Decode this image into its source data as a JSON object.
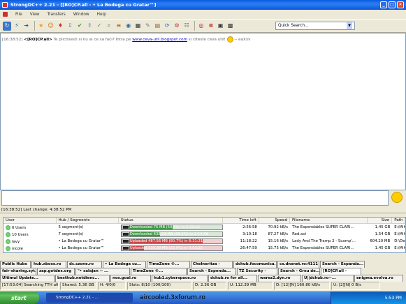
{
  "window": {
    "title": "StrongDC++ 2.21 - [[RO]CP.all - • La Bodega cu Gratar™]"
  },
  "menu": [
    "File",
    "View",
    "Transfers",
    "Window",
    "Help"
  ],
  "search": {
    "value": "Quick Search..."
  },
  "chat": {
    "time": "[16:38:52]",
    "nick": "<[RO]CP.all>",
    "text": " Te plictisesti si nu ai ce sa faci? Intra pe ",
    "link": "www.ceva-util.blogspot.com",
    "text2": " si citeste ceva util!",
    "tail": " -- eaXxv"
  },
  "status_line": "[16:38:52] Last change: 4:38:52 PM",
  "transfers": {
    "headers": [
      "User",
      "Hub / Segments",
      "Status",
      "Time left",
      "Speed",
      "Filename",
      "Size",
      "Path"
    ],
    "rows": [
      {
        "user": "6 Users",
        "hub": "5 segment(s)",
        "status": "Downloaded 76 MB (50.5%) in 2:32:15",
        "pct": 50.5,
        "type": "dl",
        "time": "2:56:58",
        "speed": "70.92 kB/s",
        "file": "The Expendables SUPER CLARI...",
        "size": "1.45 GB",
        "path": "E:\\Mihai\\"
      },
      {
        "user": "10 Users",
        "hub": "7 segment(s)",
        "status": "Downloaded 638.02 MB (38.5%) in 2:12:58",
        "pct": 38.5,
        "type": "dl",
        "time": "3:10:18",
        "speed": "87.27 kB/s",
        "file": "Red.avi",
        "size": "1.54 GB",
        "path": "E:\\Mihai\\"
      },
      {
        "user": "lavy",
        "hub": "• La Bodega cu Gratar™",
        "status": "Uploaded 487.56 MB (80.7%) in 6:31:31",
        "pct": 80.7,
        "type": "ul",
        "time": "11:18:22",
        "speed": "15.16 kB/s",
        "file": "Lady And The Tramp 2 - Scamp'...",
        "size": "604.20 MB",
        "path": "D:\\Desen"
      },
      {
        "user": "nicole",
        "hub": "• La Bodega cu Gratar™",
        "status": "Uploaded 335.38 MB (22.6%) in 0:03:25",
        "pct": 22.6,
        "type": "ul",
        "time": "26:47:59",
        "speed": "15.75 kB/s",
        "file": "The Expendables SUPER CLARI...",
        "size": "1.45 GB",
        "path": "E:\\Mihai\\"
      }
    ]
  },
  "tabs_row1": [
    "Public Hubs",
    "hub.xboss.ro",
    "dc.czone.ro",
    "• La Bodega cu...",
    "TimeZone ®...",
    "Chelneritza -",
    "dchub.focomunica...",
    "cs.dnsnet.ro:4111",
    "Search - Expanda..."
  ],
  "tabs_row2": [
    "fair-sharing.syt...",
    "zap.gotdns.org",
    "\"• salajan -- ...",
    "TimeZone ®...",
    "Search - Expenda...",
    "TZ Security -",
    "Search - Greu de...",
    "[RO]CP.all -"
  ],
  "tabs_row3": [
    "Ultimul Update...",
    "besthub.netdienc...",
    "nos.goal.ro",
    "hub1.cyberspace.ro",
    "dchub.ro for all...",
    "warez2.dyn.ro",
    "U||dchub.ro~...",
    "enigma.evolva.ro"
  ],
  "statusbar": [
    "[17:53:04] Searching TTH alte",
    "Shared: 5.36 GB",
    "H: 4/0/0",
    "Slots: 8/10 (100/100)",
    "D: 2.36 GB",
    "U: 112.39 MB",
    "D: [12][N] 160.80 kB/s",
    "U: [2][N] 0 B/s"
  ],
  "taskbar": {
    "start": "start",
    "app": "StrongDC++ 2.21 - ...",
    "clock": "5:53 PM"
  },
  "watermark": "aircooled.3xforum.ro"
}
